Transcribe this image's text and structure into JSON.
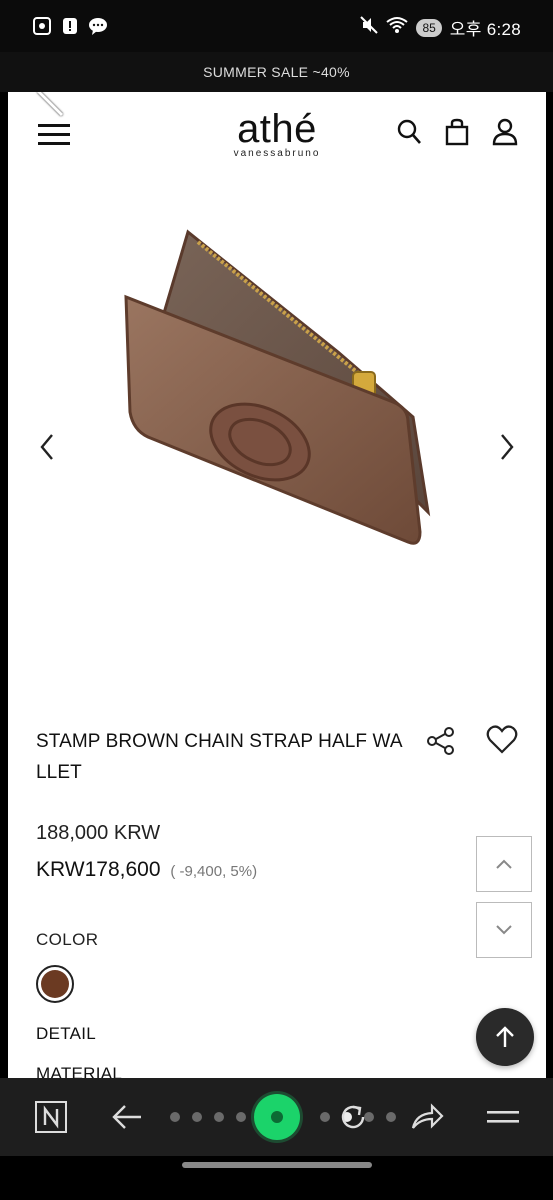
{
  "status_bar": {
    "time": "오후 6:28",
    "battery_badge": "85",
    "icons": [
      "screenshot-icon",
      "alert-icon",
      "chat-icon",
      "mute-icon",
      "wifi-icon",
      "battery-icon"
    ]
  },
  "promo_bar": {
    "text": "SUMMER SALE ~40%"
  },
  "header": {
    "logo_main": "athé",
    "logo_sub": "vanessabruno",
    "icons": [
      "menu-icon",
      "search-icon",
      "bag-icon",
      "user-icon"
    ]
  },
  "product": {
    "title": "STAMP BROWN CHAIN STRAP HALF WA LLET",
    "original_price": "188,000 KRW",
    "sale_price": "KRW178,600",
    "discount": "( -9,400, 5%)",
    "color_label": "COLOR",
    "color_swatch": "#6b3a22",
    "detail_label": "DETAIL",
    "material_label": "MATERIAL"
  },
  "colors": {
    "page_bg": "#ffffff",
    "browser_bar": "#1e1e1e",
    "accent_green": "#1bd36a"
  }
}
